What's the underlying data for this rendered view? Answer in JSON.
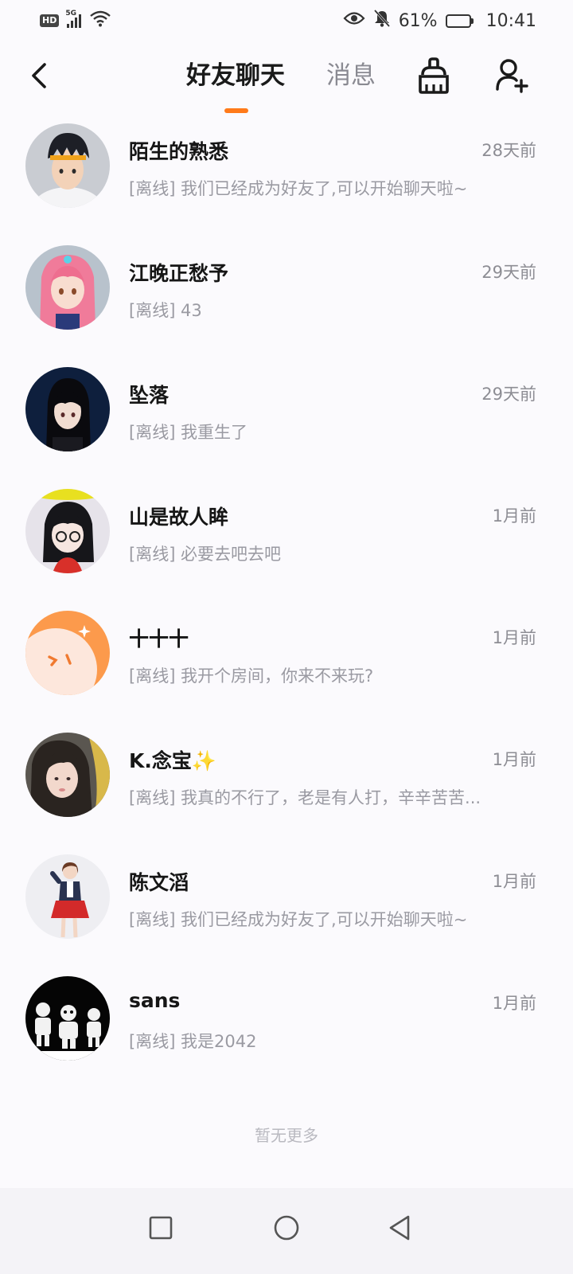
{
  "status_bar": {
    "hd": "HD",
    "network": "5G",
    "battery": "61%",
    "battery_level": 0.61,
    "time": "10:41"
  },
  "header": {
    "tabs": [
      {
        "label": "好友聊天",
        "active": true
      },
      {
        "label": "消息",
        "active": false
      }
    ],
    "accent_color": "#ff7a1a",
    "icons": [
      "back-arrow-icon",
      "broom-icon",
      "add-friend-icon"
    ]
  },
  "friends": [
    {
      "name": "陌生的熟悉",
      "time": "28天前",
      "message": "[离线] 我们已经成为好友了,可以开始聊天啦~"
    },
    {
      "name": "江晚正愁予",
      "time": "29天前",
      "message": "[离线] 43"
    },
    {
      "name": "坠落",
      "time": "29天前",
      "message": "[离线] 我重生了"
    },
    {
      "name": "山是故人眸",
      "time": "1月前",
      "message": "[离线] 必要去吧去吧"
    },
    {
      "name": "十十十",
      "time": "1月前",
      "message": "[离线] 我开个房间，你来不来玩?"
    },
    {
      "name": "K.念宝✨",
      "time": "1月前",
      "message": "[离线] 我真的不行了，老是有人打，辛辛苦苦..."
    },
    {
      "name": "陈文滔",
      "time": "1月前",
      "message": "[离线] 我们已经成为好友了,可以开始聊天啦~"
    },
    {
      "name": "sans",
      "time": "1月前",
      "message": "[离线] 我是2042"
    }
  ],
  "footer": {
    "no_more": "暂无更多"
  },
  "nav_bar": {
    "icons": [
      "recent-apps-icon",
      "home-icon",
      "back-triangle-icon"
    ]
  }
}
